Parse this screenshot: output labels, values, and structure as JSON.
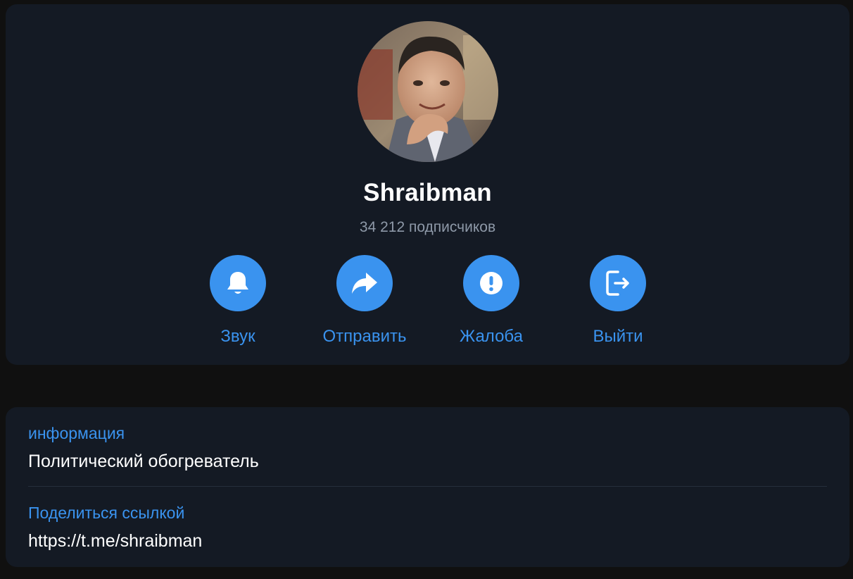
{
  "profile": {
    "name": "Shraibman",
    "subscribers": "34 212 подписчиков"
  },
  "actions": [
    {
      "label": "Звук",
      "icon": "bell-icon"
    },
    {
      "label": "Отправить",
      "icon": "share-arrow-icon"
    },
    {
      "label": "Жалоба",
      "icon": "exclamation-icon"
    },
    {
      "label": "Выйти",
      "icon": "leave-icon"
    }
  ],
  "info": {
    "about_caption": "информация",
    "about_value": "Политический обогреватель",
    "link_caption": "Поделиться ссылкой",
    "link_value": "https://t.me/shraibman"
  },
  "colors": {
    "accent": "#3a93ef",
    "card_background": "#141a24",
    "page_background": "#101010",
    "secondary_text": "#8e99a8"
  }
}
